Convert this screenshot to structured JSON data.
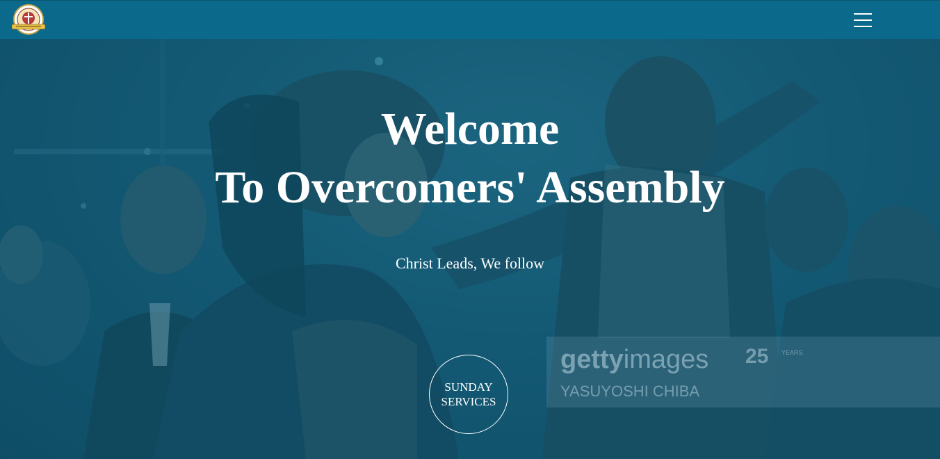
{
  "nav": {
    "logo_icon": "church-seal-logo",
    "menu_icon": "hamburger-menu-icon"
  },
  "hero": {
    "title_line1": "Welcome",
    "title_line2": "To Overcomers' Assembly",
    "tagline": "Christ Leads, We follow",
    "cta_label": "SUNDAY SERVICES"
  },
  "watermark": {
    "brand_bold": "getty",
    "brand_light": "images",
    "badge": "25",
    "badge_suffix": "YEARS",
    "credit": "YASUYOSHI CHIBA"
  },
  "colors": {
    "nav_background": "#0b6a8c",
    "hero_overlay": "#0c5c7a",
    "text": "#ffffff"
  }
}
